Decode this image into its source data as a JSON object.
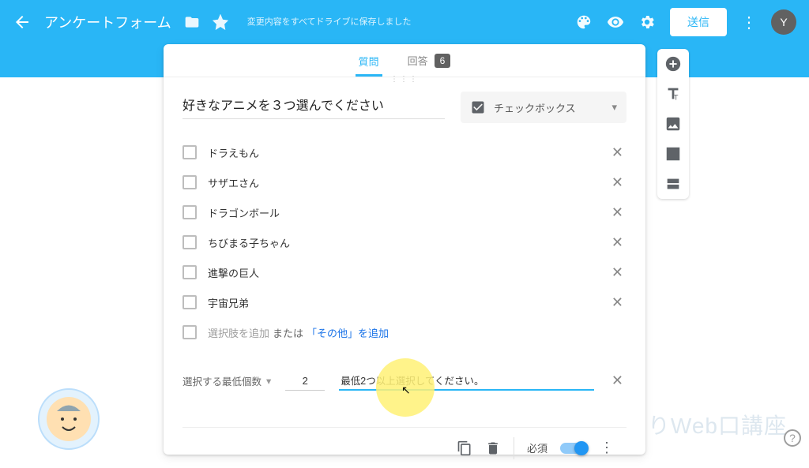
{
  "header": {
    "title": "アンケートフォーム",
    "save_status": "変更内容をすべてドライブに保存しました",
    "send_label": "送信",
    "avatar_initial": "Y"
  },
  "tabs": {
    "questions": "質問",
    "responses": "回答",
    "response_count": "6"
  },
  "question": {
    "title": "好きなアニメを３つ選んでください",
    "type_label": "チェックボックス",
    "options": [
      "ドラえもん",
      "サザエさん",
      "ドラゴンボール",
      "ちびまる子ちゃん",
      "進撃の巨人",
      "宇宙兄弟"
    ],
    "add_option": "選択肢を追加",
    "or": "または",
    "add_other": "「その他」を追加"
  },
  "validation": {
    "selector": "選択する最低個数",
    "number": "2",
    "error_msg": "最低2つ以上選択してください。"
  },
  "footer": {
    "required_label": "必須"
  },
  "watermark": "ひとりWeb口講座"
}
